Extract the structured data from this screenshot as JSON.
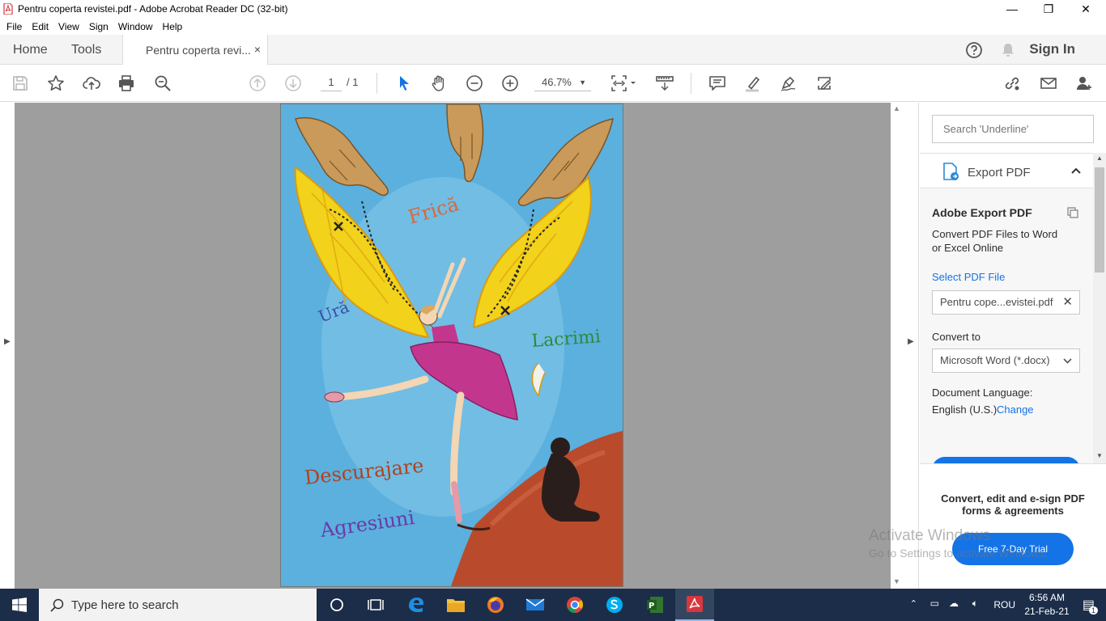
{
  "window": {
    "title": "Pentru coperta revistei.pdf - Adobe Acrobat Reader DC (32-bit)",
    "controls": {
      "minimize": "—",
      "restore": "❐",
      "close": "✕"
    }
  },
  "menu": [
    "File",
    "Edit",
    "View",
    "Sign",
    "Window",
    "Help"
  ],
  "tabs": {
    "home": "Home",
    "tools": "Tools",
    "document": "Pentru coperta revi...",
    "close_glyph": "×",
    "sign_in": "Sign In"
  },
  "toolbar": {
    "page_current": "1",
    "page_total": "/ 1",
    "zoom": "46.7%",
    "zoom_caret": "▼"
  },
  "page_art": {
    "words": [
      "Frică",
      "Ură",
      "Lacrimi",
      "Descurajare",
      "Agresiuni"
    ],
    "colors": {
      "background": "#4aa6d9",
      "wings": "#f2d21a",
      "skirt": "#c2378d",
      "ground": "#b94a2c"
    }
  },
  "right_pane": {
    "search_placeholder": "Search 'Underline'",
    "export_header": "Export PDF",
    "export_title": "Adobe Export PDF",
    "export_desc": "Convert PDF Files to Word or Excel Online",
    "select_file": "Select PDF File",
    "file_name": "Pentru cope...evistei.pdf",
    "convert_to_label": "Convert to",
    "convert_to_value": "Microsoft Word (*.docx)",
    "doc_lang_label": "Document Language:",
    "doc_lang_value": "English (U.S.)",
    "change_link": "Change",
    "promo": "Convert, edit and e-sign PDF forms & agreements",
    "trial_button": "Free 7-Day Trial"
  },
  "watermark": {
    "line1": "Activate Windows",
    "line2": "Go to Settings to activate Windows."
  },
  "taskbar": {
    "search_placeholder": "Type here to search",
    "language": "ROU",
    "time": "6:56 AM",
    "date": "21-Feb-21",
    "notification_count": "1"
  },
  "accent": "#1473e6"
}
